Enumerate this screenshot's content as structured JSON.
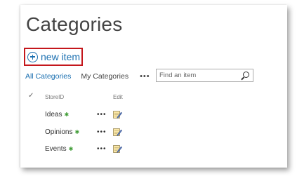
{
  "page": {
    "title": "Categories"
  },
  "actions": {
    "new_item_label": "new item"
  },
  "views": {
    "items": [
      {
        "label": "All Categories",
        "active": true
      },
      {
        "label": "My Categories",
        "active": false
      }
    ],
    "more_label": "•••"
  },
  "search": {
    "placeholder": "Find an item"
  },
  "table": {
    "check_label": "✓",
    "columns": [
      "StoreID",
      "Edit"
    ],
    "row_menu_label": "•••",
    "rows": [
      {
        "name": "Ideas",
        "new_badge": "✱"
      },
      {
        "name": "Opinions",
        "new_badge": "✱"
      },
      {
        "name": "Events",
        "new_badge": "✱"
      }
    ]
  },
  "colors": {
    "link": "#1a6fb0",
    "highlight_border": "#c4171c",
    "new_badge": "#3f9c35",
    "title": "#444444"
  },
  "icons": [
    "plus-circle-icon",
    "search-icon",
    "check-icon",
    "new-badge-icon",
    "edit-icon"
  ]
}
